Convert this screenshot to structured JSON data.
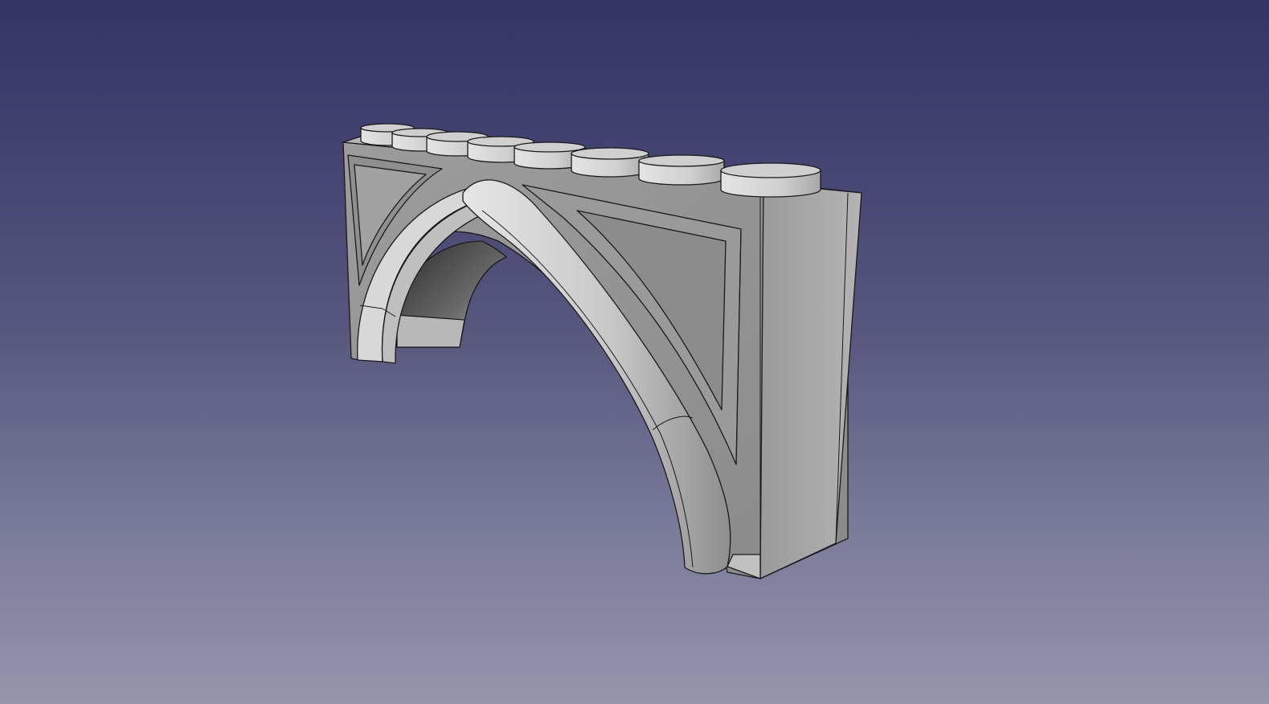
{
  "viewport": {
    "background_top": "#333366",
    "background_bottom": "#9595ad"
  },
  "model": {
    "kind": "arch-brick-with-studs",
    "stud_count": 8,
    "face_color_light": "#c8c8c8",
    "face_color_mid": "#a9a9a9",
    "face_color_dark": "#8c8c8c",
    "edge_color": "#1a1a1a"
  }
}
